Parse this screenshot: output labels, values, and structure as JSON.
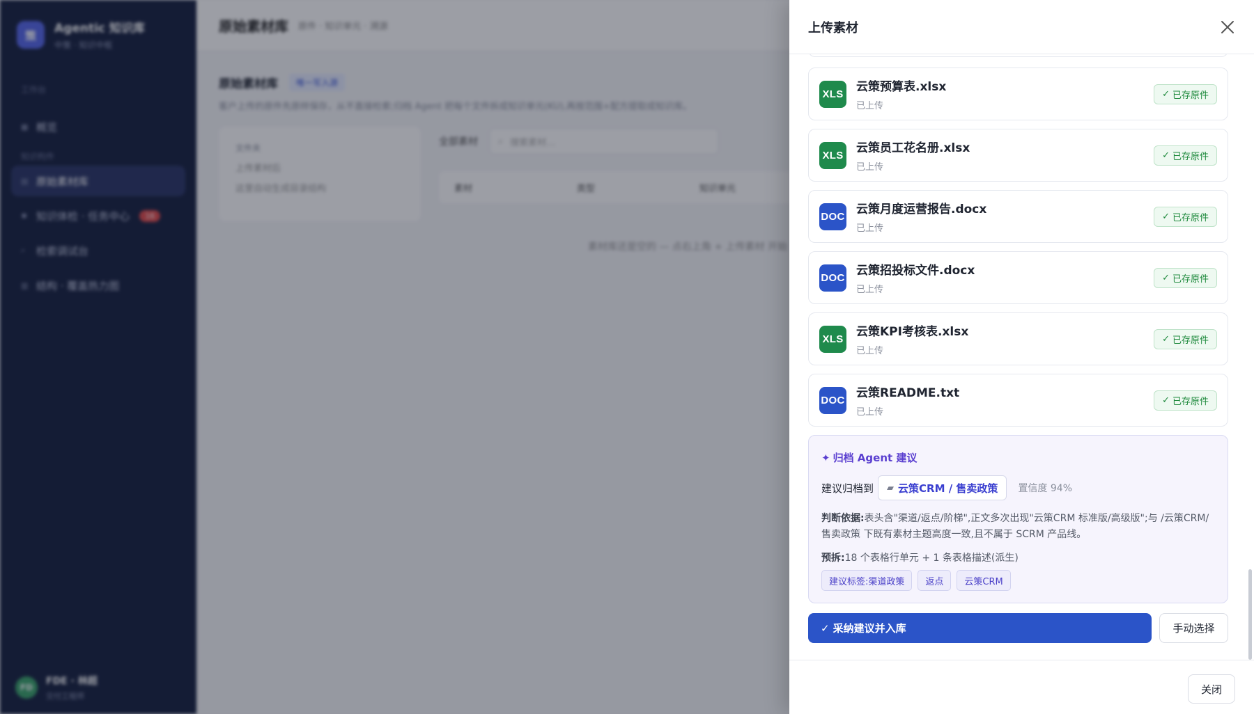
{
  "sidebar": {
    "brand_name": "Agentic 知识库",
    "brand_sub": "中策 · 知识中枢",
    "brand_logo": "策",
    "section_workspace": "工作台",
    "section_knowledge": "知识构件",
    "items": [
      {
        "label": "概览",
        "icon": "grid-icon"
      },
      {
        "label": "原始素材库",
        "icon": "folder-icon",
        "active": true
      },
      {
        "label": "知识体检 · 任务中心",
        "icon": "check-icon",
        "badge": "16"
      },
      {
        "label": "检索调试台",
        "icon": "search-icon"
      },
      {
        "label": "结构 · 覆盖热力图",
        "icon": "heatmap-icon"
      }
    ],
    "user_initials": "FD",
    "user_name": "FDE · 林超",
    "user_role": "交付工程师"
  },
  "main": {
    "title": "原始素材库",
    "crumb": "原件 · 知识单元 · 溯源",
    "section_title": "原始素材库",
    "section_tag": "唯一写入源",
    "section_desc": "客户上传的原件先原样保存，从不直接检索;归档 Agent 把每个文件拆成知识单元(KU),再按范围+配方提取成知识库。",
    "folder_head": "文件夹",
    "folder_line1": "上传素材后",
    "folder_line2": "这里自动生成目录结构",
    "filter_label": "全部素材",
    "search_placeholder": "搜索素材…",
    "table_headers": [
      "素材",
      "类型",
      "知识单元"
    ],
    "empty_text": "素材库还是空的 — 点右上角 + 上传素材 开始"
  },
  "drawer": {
    "title": "上传素材",
    "files": [
      {
        "name": "云策预算表.xlsx",
        "status": "已上传",
        "type": "XLS",
        "color": "#1f8a4c",
        "badge": "已存原件"
      },
      {
        "name": "云策员工花名册.xlsx",
        "status": "已上传",
        "type": "XLS",
        "color": "#1f8a4c",
        "badge": "已存原件"
      },
      {
        "name": "云策月度运营报告.docx",
        "status": "已上传",
        "type": "DOC",
        "color": "#2b54c8",
        "badge": "已存原件"
      },
      {
        "name": "云策招投标文件.docx",
        "status": "已上传",
        "type": "DOC",
        "color": "#2b54c8",
        "badge": "已存原件"
      },
      {
        "name": "云策KPI考核表.xlsx",
        "status": "已上传",
        "type": "XLS",
        "color": "#1f8a4c",
        "badge": "已存原件"
      },
      {
        "name": "云策README.txt",
        "status": "已上传",
        "type": "DOC",
        "color": "#2b54c8",
        "badge": "已存原件"
      }
    ],
    "agent": {
      "title": "归档 Agent 建议",
      "suggest_label": "建议归档到",
      "suggest_target": "云策CRM / 售卖政策",
      "confidence": "置信度 94%",
      "basis_label": "判断依据:",
      "basis_text": "表头含\"渠道/返点/阶梯\",正文多次出现\"云策CRM 标准版/高级版\";与 /云策CRM/售卖政策 下既有素材主题高度一致,且不属于 SCRM 产品线。",
      "predict_label": "预拆:",
      "predict_text": "18 个表格行单元 + 1 条表格描述(派生)",
      "tags": [
        "建议标签:渠道政策",
        "返点",
        "云策CRM"
      ]
    },
    "accept_label": "采纳建议并入库",
    "manual_label": "手动选择",
    "close_label": "关闭"
  }
}
